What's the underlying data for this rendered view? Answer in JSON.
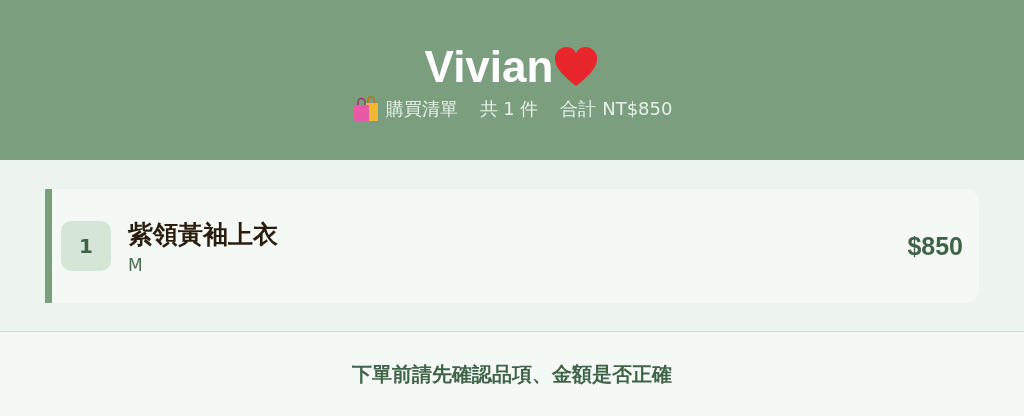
{
  "header": {
    "title": "Vivian",
    "subtitle": [
      "購買清單",
      "共 1 件",
      "合計 NT$850"
    ]
  },
  "items": [
    {
      "index": "1",
      "name": "紫領黃袖上衣",
      "variant": "M",
      "price": "$850"
    }
  ],
  "footer": {
    "notice": "下單前請先確認品項、金額是否正確"
  }
}
